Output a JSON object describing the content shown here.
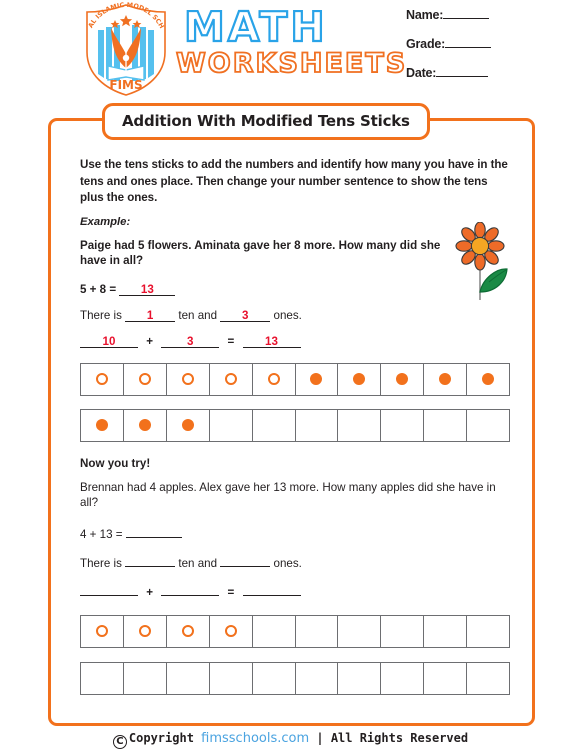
{
  "header": {
    "brand_line1": "MATH",
    "brand_line2": "WORKSHEETS",
    "logo": {
      "arc_text": "FAISAL ISLAMIC MODEL SCHOOL",
      "monogram": "FIMS"
    },
    "fields": [
      {
        "label": "Name:",
        "value": ""
      },
      {
        "label": "Grade:",
        "value": ""
      },
      {
        "label": "Date:",
        "value": ""
      }
    ]
  },
  "title": "Addition With Modified Tens Sticks",
  "instructions": "Use the tens sticks to add the numbers and identify how many you have in the tens and ones place. Then change your number sentence to show the tens plus the ones.",
  "example": {
    "label": "Example:",
    "problem": "Paige had 5 flowers. Aminata gave her 8 more. How many did she have in all?",
    "sum_prefix": "5 + 8  =",
    "sum_answer": "13",
    "there_is": "There is",
    "ten_word": "ten and",
    "ones_word": "ones.",
    "tens_answer": "1",
    "ones_answer": "3",
    "expand_left": "10",
    "expand_plus": "+",
    "expand_right": "3",
    "expand_equals": "=",
    "expand_total": "13",
    "grid_row1": [
      "hollow",
      "hollow",
      "hollow",
      "hollow",
      "hollow",
      "filled",
      "filled",
      "filled",
      "filled",
      "filled"
    ],
    "grid_row2": [
      "filled",
      "filled",
      "filled",
      "none",
      "none",
      "none",
      "none",
      "none",
      "none",
      "none"
    ]
  },
  "practice": {
    "heading": "Now you try!",
    "problem": "Brennan had 4 apples. Alex gave her 13 more. How many apples did she have in all?",
    "sum_prefix": "4 + 13  =",
    "sum_answer": "",
    "there_is": "There is",
    "ten_word": "ten and",
    "ones_word": "ones.",
    "tens_answer": "",
    "ones_answer": "",
    "expand_left": "",
    "expand_plus": "+",
    "expand_right": "",
    "expand_equals": "=",
    "expand_total": "",
    "grid_row1": [
      "hollow",
      "hollow",
      "hollow",
      "hollow",
      "none",
      "none",
      "none",
      "none",
      "none",
      "none"
    ],
    "grid_row2": [
      "none",
      "none",
      "none",
      "none",
      "none",
      "none",
      "none",
      "none",
      "none",
      "none"
    ]
  },
  "footer": {
    "copyright_symbol": "C",
    "copyright_text": "Copyright",
    "site": "fimsschools.com",
    "rights": "| All Rights Reserved"
  },
  "colors": {
    "accent_orange": "#f2711c",
    "brand_blue": "#29a3e8",
    "answer_red": "#e8112d",
    "grid_gray": "#6d6e71",
    "link_blue": "#4aa3e0"
  }
}
